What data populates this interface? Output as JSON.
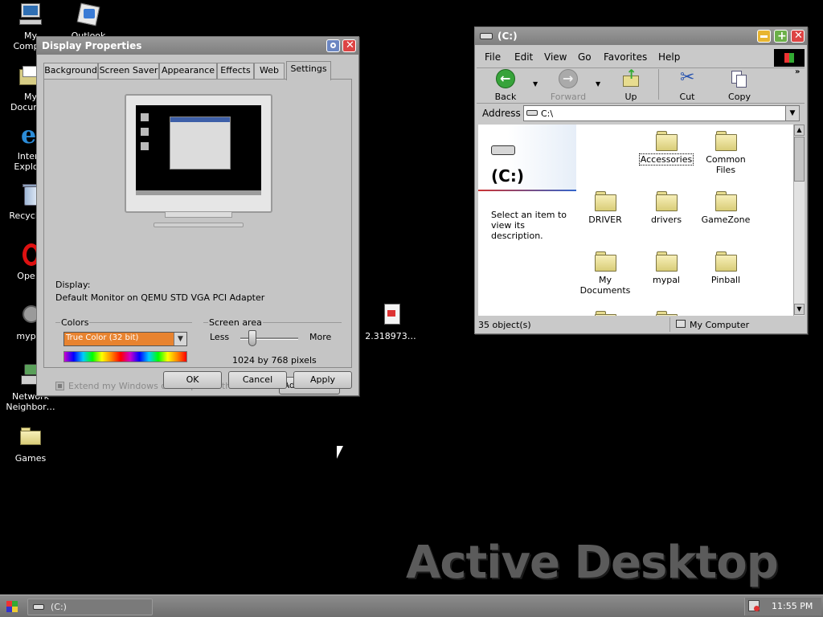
{
  "desktop": {
    "icons": [
      {
        "name": "my-computer",
        "label": "My\nComp…"
      },
      {
        "name": "outlook",
        "label": "Outlook"
      },
      {
        "name": "my-documents",
        "label": "My\nDocum…"
      },
      {
        "name": "internet-explorer",
        "label": "Intern\nExplo…"
      },
      {
        "name": "recycle-bin",
        "label": "Recycle…"
      },
      {
        "name": "opera",
        "label": "Ope…"
      },
      {
        "name": "mypal",
        "label": "myp…"
      },
      {
        "name": "network-neighborhood",
        "label": "Network\nNeighbor…"
      },
      {
        "name": "games",
        "label": "Games"
      },
      {
        "name": "file-2318973",
        "label": "2.318973…"
      }
    ],
    "watermark": "Active Desktop"
  },
  "display_properties": {
    "title": "Display Properties",
    "tabs": [
      "Background",
      "Screen Saver",
      "Appearance",
      "Effects",
      "Web",
      "Settings"
    ],
    "selected_tab": "Settings",
    "display_label": "Display:",
    "display_value": "Default Monitor on QEMU STD VGA PCI Adapter",
    "colors_group": "Colors",
    "colors_value": "True Color (32 bit)",
    "screen_area_group": "Screen area",
    "less_label": "Less",
    "more_label": "More",
    "screen_area_value": "1024 by 768 pixels",
    "extend_label": "Extend my Windows desktop onto this monitor",
    "advanced_button": "Advanced...",
    "ok_button": "OK",
    "cancel_button": "Cancel",
    "apply_button": "Apply"
  },
  "explorer": {
    "title": "(C:)",
    "menu": [
      "File",
      "Edit",
      "View",
      "Go",
      "Favorites",
      "Help"
    ],
    "toolbar": {
      "back": "Back",
      "forward": "Forward",
      "up": "Up",
      "cut": "Cut",
      "copy": "Copy"
    },
    "address_label": "Address",
    "address_value": "C:\\",
    "drive_heading": "(C:)",
    "info_text": "Select an item to view its description.",
    "folders": [
      "Accessories",
      "Common Files",
      "DRIVER",
      "drivers",
      "GameZone",
      "My Documents",
      "mypal",
      "Pinball"
    ],
    "status_objects": "35 object(s)",
    "status_zone": "My Computer"
  },
  "taskbar": {
    "task_label": "(C:)",
    "clock": "11:55 PM"
  },
  "colors": {
    "desktop": "#000000",
    "titlebar": "#8a8a8a",
    "color_bar_fill": "#e8832f",
    "folder": "#e8dc8a"
  }
}
